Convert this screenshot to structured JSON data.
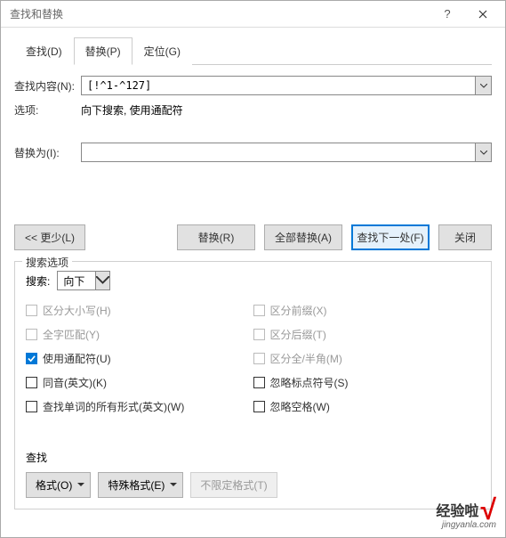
{
  "titlebar": {
    "title": "查找和替换"
  },
  "tabs": {
    "find": "查找(D)",
    "replace": "替换(P)",
    "goto": "定位(G)"
  },
  "form": {
    "find_label": "查找内容(N):",
    "find_value": "[!^1-^127]",
    "options_label": "选项:",
    "options_value": "向下搜索, 使用通配符",
    "replace_label": "替换为(I):",
    "replace_value": ""
  },
  "buttons": {
    "less": "<< 更少(L)",
    "replace": "替换(R)",
    "replace_all": "全部替换(A)",
    "find_next": "查找下一处(F)",
    "close": "关闭"
  },
  "search_options": {
    "legend": "搜索选项",
    "direction_label": "搜索:",
    "direction_value": "向下",
    "match_case": "区分大小写(H)",
    "whole_word": "全字匹配(Y)",
    "use_wildcards": "使用通配符(U)",
    "sounds_like": "同音(英文)(K)",
    "all_word_forms": "查找单词的所有形式(英文)(W)",
    "match_prefix": "区分前缀(X)",
    "match_suffix": "区分后缀(T)",
    "match_width": "区分全/半角(M)",
    "ignore_punct": "忽略标点符号(S)",
    "ignore_space": "忽略空格(W)"
  },
  "bottom": {
    "label": "查找",
    "format": "格式(O)",
    "special": "特殊格式(E)",
    "no_format": "不限定格式(T)"
  },
  "watermark": {
    "text": "经验啦",
    "sub": "jingyanla.com"
  }
}
